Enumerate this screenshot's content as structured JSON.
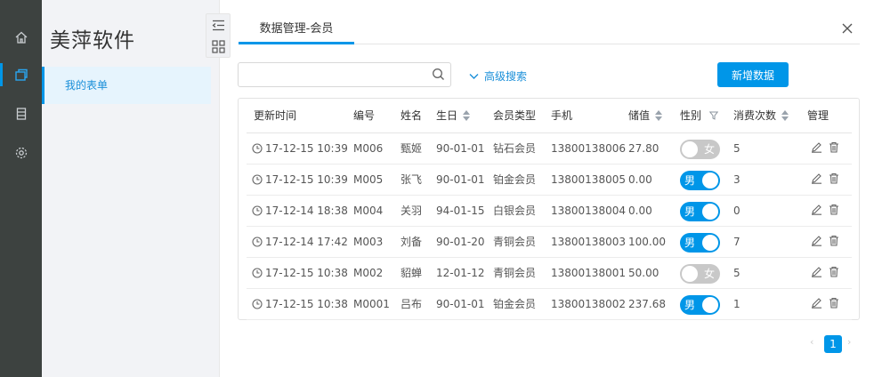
{
  "app": {
    "brand": "美萍软件"
  },
  "sidebar": {
    "items": [
      {
        "label": "我的表单"
      }
    ]
  },
  "tabs": [
    {
      "label": "数据管理-会员"
    }
  ],
  "search": {
    "placeholder": "",
    "value": ""
  },
  "toolbar": {
    "advanced_search": "高级搜索",
    "add_button": "新增数据"
  },
  "table": {
    "columns": [
      "更新时间",
      "编号",
      "姓名",
      "生日",
      "会员类型",
      "手机",
      "储值",
      "性别",
      "消费次数",
      "管理"
    ],
    "rows": [
      {
        "updated": "17-12-15 10:39",
        "id": "M006",
        "name": "甄姬",
        "birthday": "90-01-01",
        "member_type": "钻石会员",
        "phone": "13800138006",
        "balance": "27.80",
        "gender": "女",
        "gender_on": false,
        "visits": "5"
      },
      {
        "updated": "17-12-15 10:39",
        "id": "M005",
        "name": "张飞",
        "birthday": "90-01-01",
        "member_type": "铂金会员",
        "phone": "13800138005",
        "balance": "0.00",
        "gender": "男",
        "gender_on": true,
        "visits": "3"
      },
      {
        "updated": "17-12-14 18:38",
        "id": "M004",
        "name": "关羽",
        "birthday": "94-01-15",
        "member_type": "白银会员",
        "phone": "13800138004",
        "balance": "0.00",
        "gender": "男",
        "gender_on": true,
        "visits": "0"
      },
      {
        "updated": "17-12-14 17:42",
        "id": "M003",
        "name": "刘备",
        "birthday": "90-01-20",
        "member_type": "青铜会员",
        "phone": "13800138003",
        "balance": "100.00",
        "gender": "男",
        "gender_on": true,
        "visits": "7"
      },
      {
        "updated": "17-12-15 10:38",
        "id": "M002",
        "name": "貂蝉",
        "birthday": "12-01-12",
        "member_type": "青铜会员",
        "phone": "13800138001",
        "balance": "50.00",
        "gender": "女",
        "gender_on": false,
        "visits": "5"
      },
      {
        "updated": "17-12-15 10:38",
        "id": "M0001",
        "name": "吕布",
        "birthday": "90-01-01",
        "member_type": "铂金会员",
        "phone": "13800138002",
        "balance": "237.68",
        "gender": "男",
        "gender_on": true,
        "visits": "1"
      }
    ]
  },
  "pagination": {
    "current": "1",
    "prev": "‹",
    "next": "›"
  },
  "colors": {
    "accent": "#0096e8",
    "rail": "#3d4240",
    "toggle_off": "#c8c8c8"
  },
  "icons": [
    "home-icon",
    "layers-icon",
    "document-icon",
    "gear-icon",
    "outdent-icon",
    "grid-icon",
    "close-icon",
    "search-icon",
    "chevron-down-icon",
    "clock-icon",
    "filter-icon",
    "edit-icon",
    "trash-icon"
  ]
}
